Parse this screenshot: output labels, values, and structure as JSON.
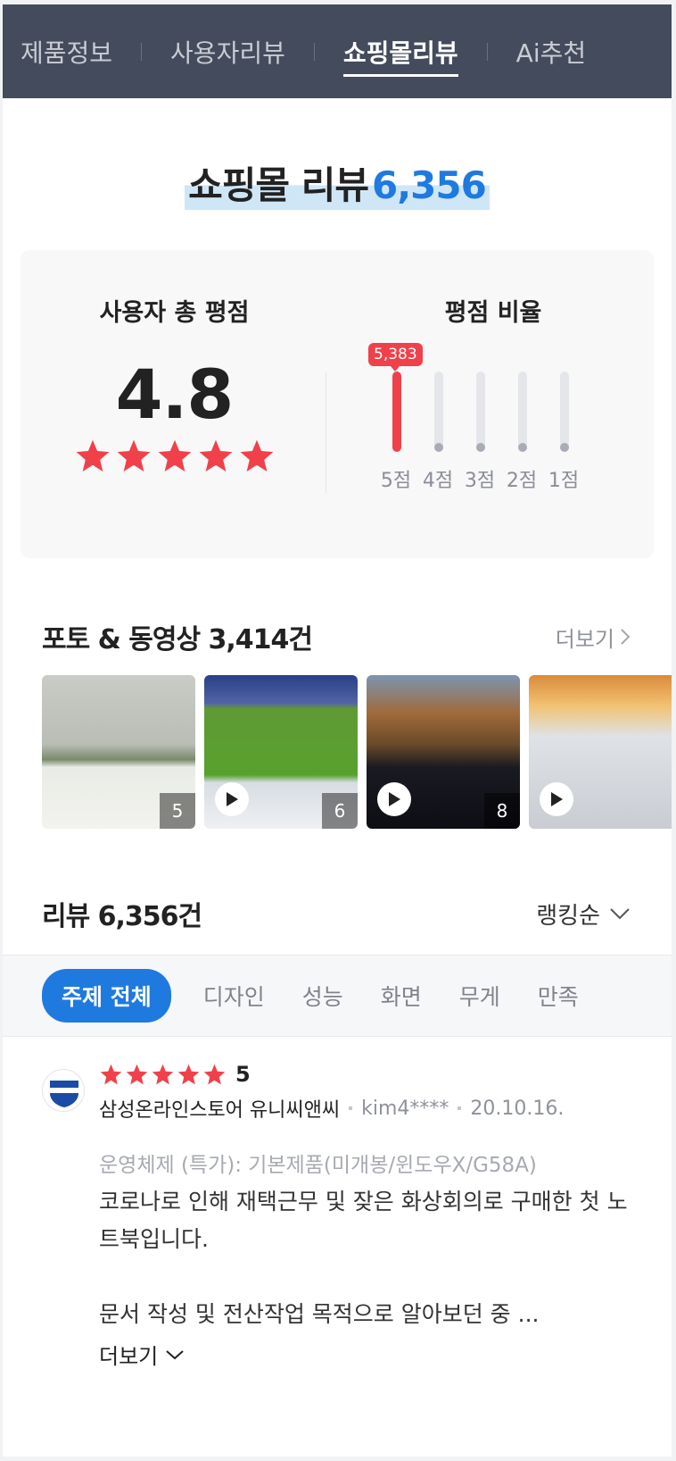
{
  "tabs": [
    {
      "label": "제품정보",
      "active": false
    },
    {
      "label": "사용자리뷰",
      "active": false
    },
    {
      "label": "쇼핑몰리뷰",
      "active": true
    },
    {
      "label": "Ai추천",
      "active": false
    }
  ],
  "header": {
    "title": "쇼핑몰 리뷰",
    "count": "6,356"
  },
  "rating": {
    "total_label": "사용자 총 평점",
    "score": "4.8",
    "stars": 5,
    "ratio_label": "평점 비율",
    "bars": [
      {
        "label": "5점",
        "fraction": 1.0,
        "count": "5,383"
      },
      {
        "label": "4점",
        "fraction": 0.0
      },
      {
        "label": "3점",
        "fraction": 0.0
      },
      {
        "label": "2점",
        "fraction": 0.0
      },
      {
        "label": "1점",
        "fraction": 0.0
      }
    ]
  },
  "photos": {
    "title": "포토 & 동영상 3,414건",
    "more_label": "더보기",
    "items": [
      {
        "count": "5",
        "video": false
      },
      {
        "count": "6",
        "video": true
      },
      {
        "count": "8",
        "video": true
      },
      {
        "count": "",
        "video": true
      }
    ]
  },
  "reviews": {
    "title": "리뷰 6,356건",
    "sort_label": "랭킹순",
    "chips": [
      "주제 전체",
      "디자인",
      "성능",
      "화면",
      "무게",
      "만족"
    ],
    "item": {
      "score": "5",
      "store": "삼성온라인스토어 유니씨앤씨",
      "user": "kim4****",
      "date": "20.10.16.",
      "option": "운영체제 (특가): 기본제품(미개봉/윈도우X/G58A)",
      "text1": "코로나로 인해 재택근무 및 잦은 화상회의로  구매한 첫 노트북입니다.",
      "text2": "문서 작성 및 전산작업 목적으로 알아보던 중 ...",
      "more_label": "더보기",
      "avatar_text_top": "SAMSUNG",
      "avatar_text_bottom": "공식파트너"
    }
  },
  "colors": {
    "accent": "#1f7ae0",
    "star": "#f0414b",
    "tabbar": "#444b5c"
  }
}
